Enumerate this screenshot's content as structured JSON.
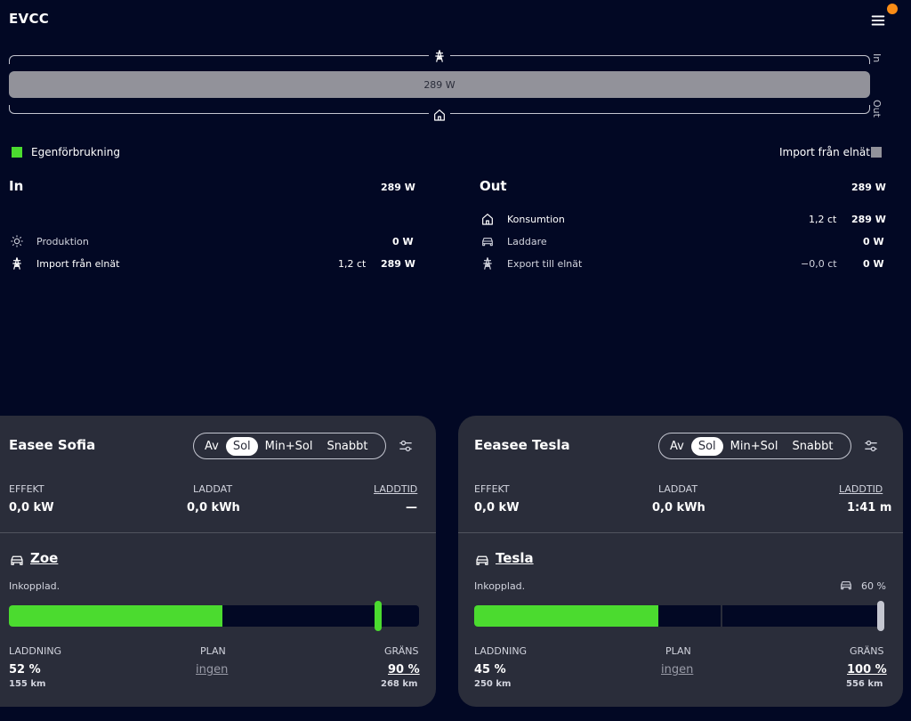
{
  "header": {
    "title": "EVCC"
  },
  "energyflow": {
    "bar_value": "289 W",
    "in_label": "In",
    "out_label": "Out",
    "legend": {
      "left": {
        "label": "Egenförbrukning",
        "color": "#4bdb2f"
      },
      "right": {
        "label": "Import från elnät",
        "color": "#92929a"
      }
    }
  },
  "in_section": {
    "title": "In",
    "total": "289 W",
    "rows": [
      {
        "icon": "sun-icon",
        "label": "Produktion",
        "price": "",
        "value": "0 W"
      },
      {
        "icon": "grid-tower-icon",
        "label": "Import från elnät",
        "price": "1,2 ct",
        "value": "289 W"
      }
    ]
  },
  "out_section": {
    "title": "Out",
    "total": "289 W",
    "rows": [
      {
        "icon": "home-icon",
        "label": "Konsumtion",
        "price": "1,2 ct",
        "value": "289 W"
      },
      {
        "icon": "car-icon",
        "label": "Laddare",
        "price": "",
        "value": "0 W"
      },
      {
        "icon": "grid-tower-icon",
        "label": "Export till elnät",
        "price": "−0,0 ct",
        "value": "0 W"
      }
    ]
  },
  "loadpoints": [
    {
      "title": "Easee Sofia",
      "modes": [
        "Av",
        "Sol",
        "Min+Sol",
        "Snabbt"
      ],
      "active_mode": "Sol",
      "effekt_label": "EFFEKT",
      "effekt_value": "0,0 kW",
      "laddat_label": "LADDAT",
      "laddat_value": "0,0 kWh",
      "laddtid_label": "LADDTID",
      "laddtid_value": "—",
      "vehicle_name": "Zoe",
      "status": "Inkopplad.",
      "vehicle_limit": "",
      "soc_percent": 52,
      "limit_percent": 90,
      "laddning_label": "LADDNING",
      "laddning_value": "52 %",
      "laddning_range": "155 km",
      "plan_label": "PLAN",
      "plan_value": "ingen",
      "grans_label": "GRÄNS",
      "grans_value": "90 %",
      "grans_range": "268 km"
    },
    {
      "title": "Eeasee Tesla",
      "modes": [
        "Av",
        "Sol",
        "Min+Sol",
        "Snabbt"
      ],
      "active_mode": "Sol",
      "effekt_label": "EFFEKT",
      "effekt_value": "0,0 kW",
      "laddat_label": "LADDAT",
      "laddat_value": "0,0 kWh",
      "laddtid_label": "LADDTID",
      "laddtid_value": "1:41 m",
      "vehicle_name": "Tesla",
      "status": "Inkopplad.",
      "vehicle_limit": "60 %",
      "soc_percent": 45,
      "limit_percent": 100,
      "vehicle_limit_percent": 60,
      "laddning_label": "LADDNING",
      "laddning_value": "45 %",
      "laddning_range": "250 km",
      "plan_label": "PLAN",
      "plan_value": "ingen",
      "grans_label": "GRÄNS",
      "grans_value": "100 %",
      "grans_range": "556 km"
    }
  ]
}
